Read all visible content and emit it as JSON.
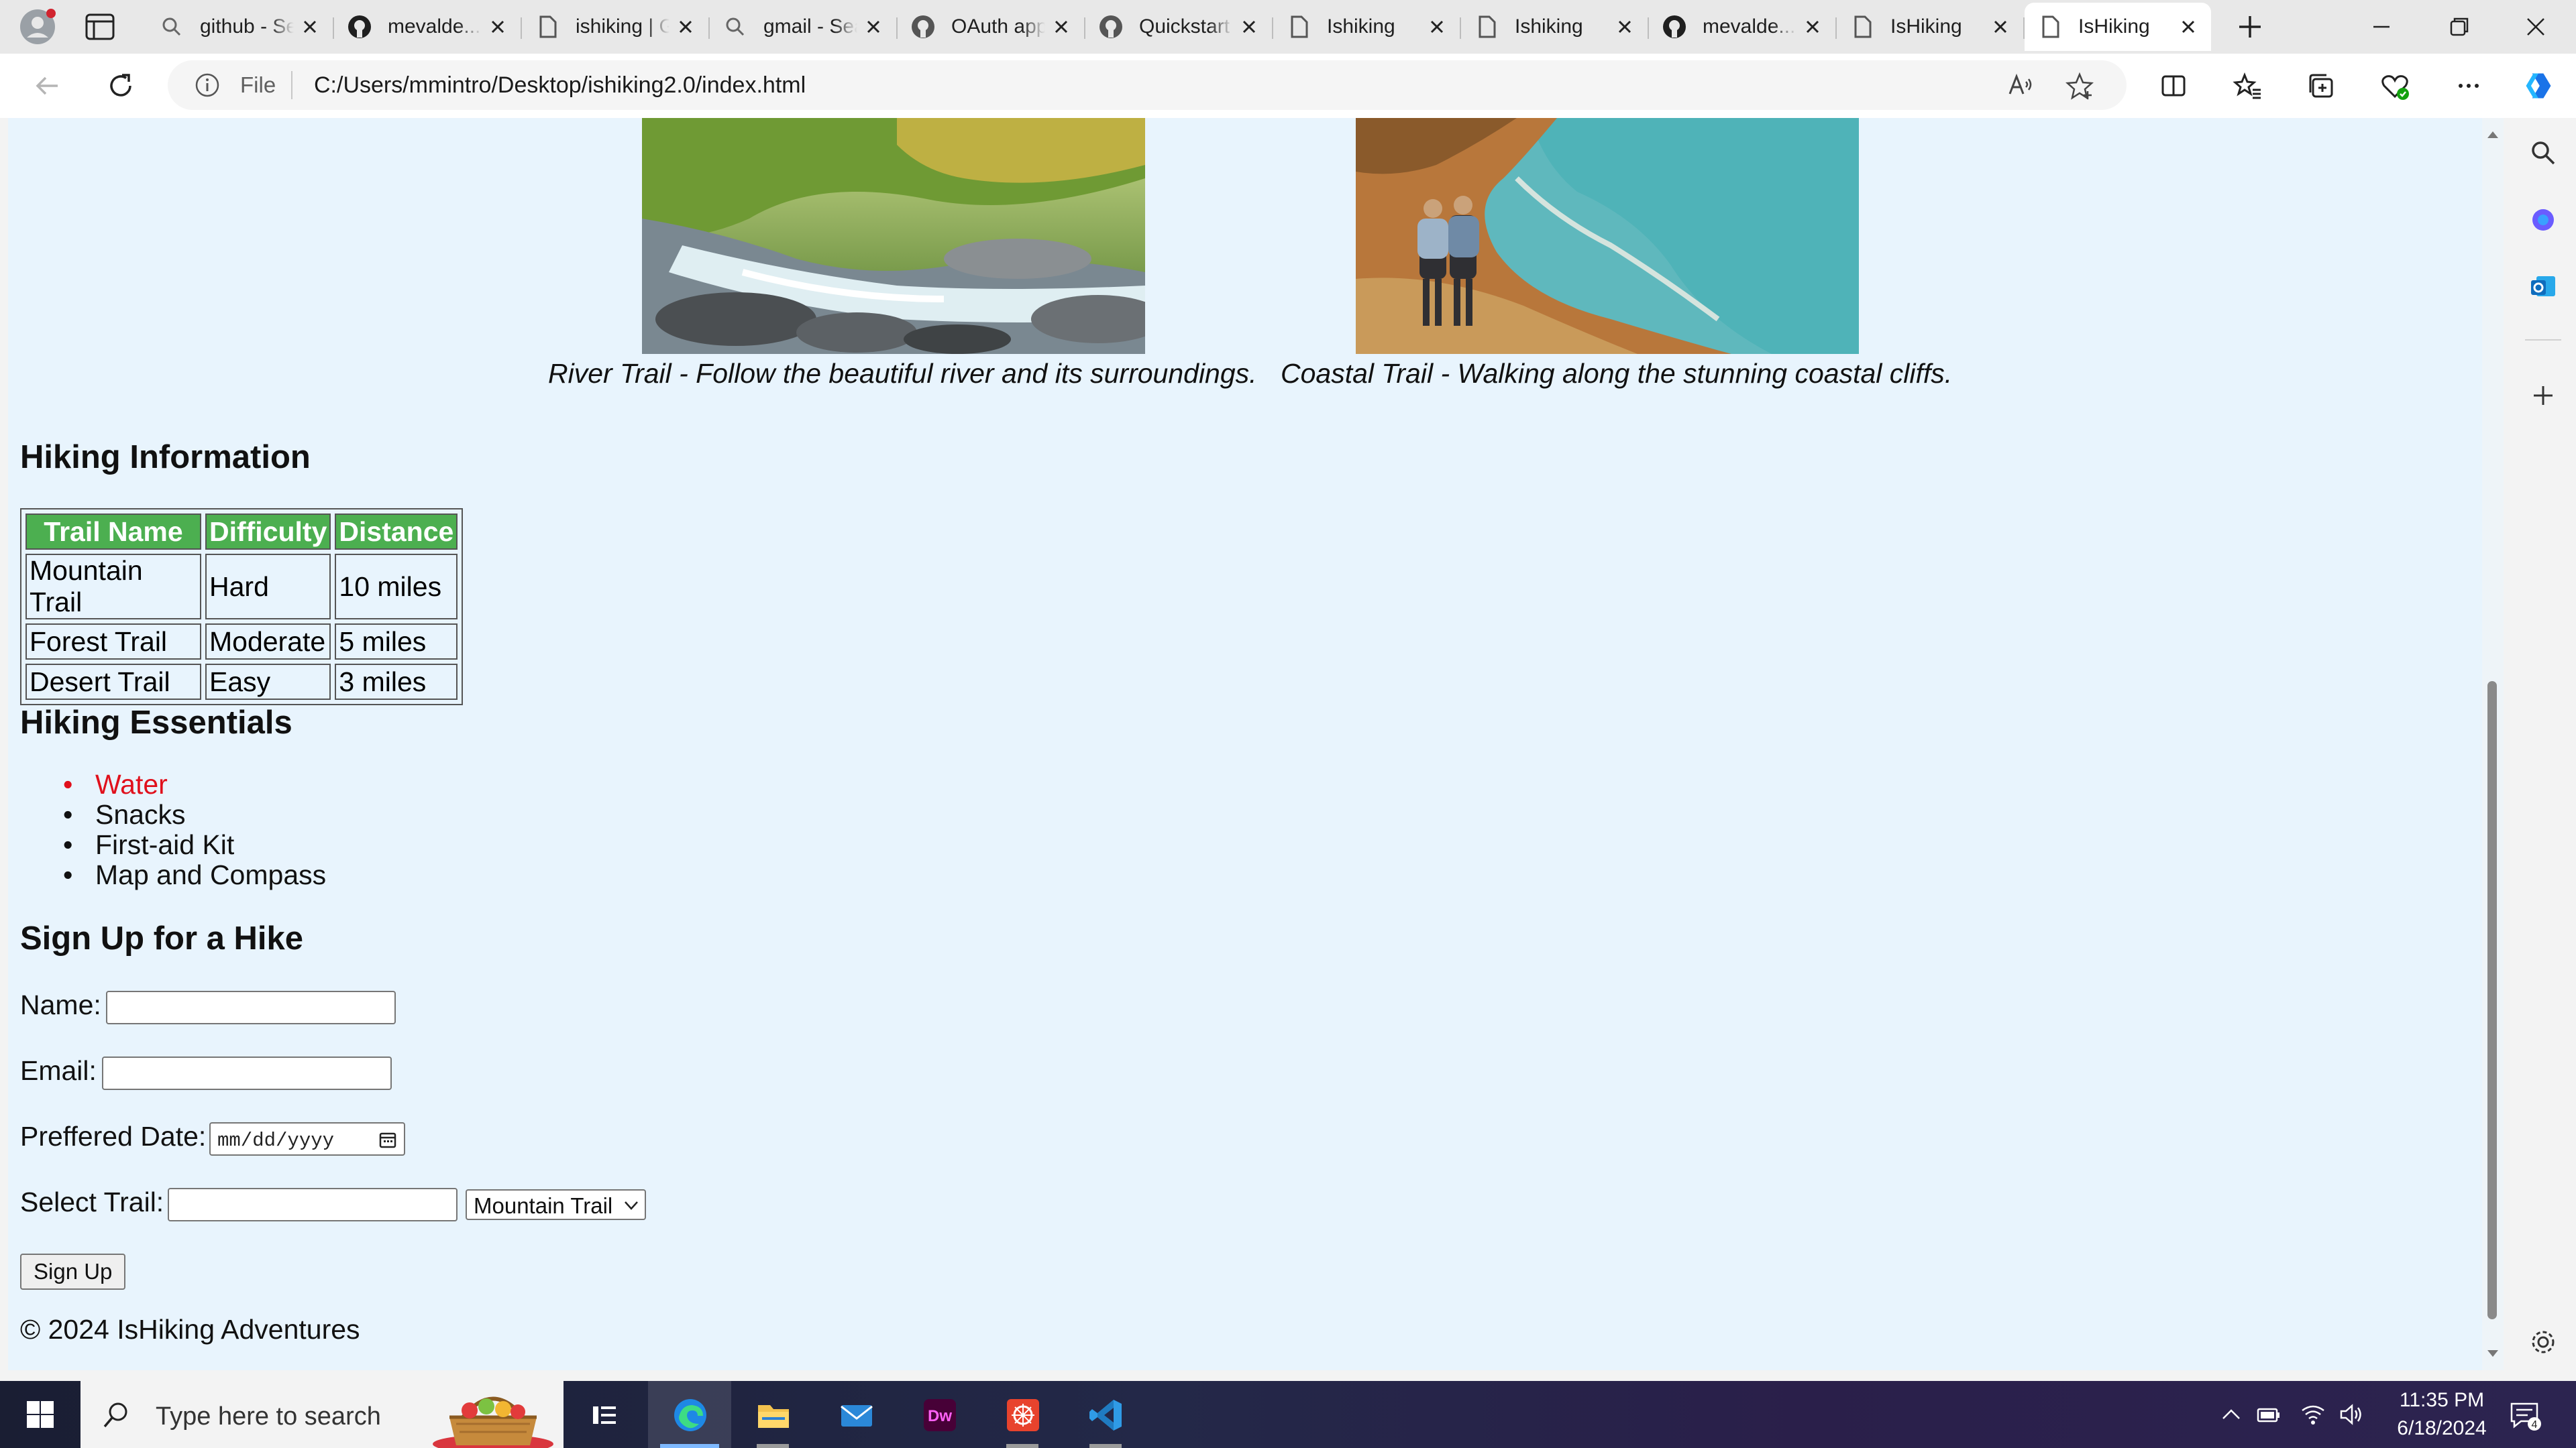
{
  "browser": {
    "tabs": [
      {
        "label": "github - Search",
        "icon": "search-icon"
      },
      {
        "label": "mevalde...",
        "icon": "github-icon"
      },
      {
        "label": "ishiking | GitHub",
        "icon": "page-icon"
      },
      {
        "label": "gmail - Search",
        "icon": "search-icon"
      },
      {
        "label": "OAuth apps",
        "icon": "github-icon"
      },
      {
        "label": "Quickstart",
        "icon": "github-icon"
      },
      {
        "label": "Ishiking",
        "icon": "page-icon"
      },
      {
        "label": "Ishiking",
        "icon": "page-icon"
      },
      {
        "label": "mevalde...",
        "icon": "github-icon"
      },
      {
        "label": "IsHiking",
        "icon": "page-icon"
      },
      {
        "label": "IsHiking",
        "icon": "page-icon",
        "active": true
      }
    ],
    "address": {
      "scheme": "File",
      "url": "C:/Users/mmintro/Desktop/ishiking2.0/index.html"
    }
  },
  "page": {
    "gallery": [
      {
        "caption": "River Trail - Follow the beautiful river and its surroundings."
      },
      {
        "caption": "Coastal Trail - Walking along the stunning coastal cliffs."
      }
    ],
    "info_heading": "Hiking Information",
    "table": {
      "headers": [
        "Trail Name",
        "Difficulty",
        "Distance"
      ],
      "rows": [
        [
          "Mountain Trail",
          "Hard",
          "10 miles"
        ],
        [
          "Forest Trail",
          "Moderate",
          "5 miles"
        ],
        [
          "Desert Trail",
          "Easy",
          "3 miles"
        ]
      ],
      "header_color": "#4caf50"
    },
    "essentials_heading": "Hiking Essentials",
    "essentials": [
      "Water",
      "Snacks",
      "First-aid Kit",
      "Map and Compass"
    ],
    "highlight_color": "#e0101c",
    "signup": {
      "heading": "Sign Up for a Hike",
      "name_label": "Name:",
      "email_label": "Email:",
      "date_label": "Preffered Date:",
      "date_placeholder": "mm/dd/yyyy",
      "trail_label": "Select Trail:",
      "trail_selected": "Mountain Trail",
      "button": "Sign Up"
    },
    "footer": "© 2024 IsHiking Adventures",
    "background": "#e8f4fd"
  },
  "taskbar": {
    "search_placeholder": "Type here to search",
    "apps": [
      "task-view",
      "edge",
      "file-explorer",
      "mail",
      "dreamweaver",
      "app-red",
      "vscode"
    ],
    "time": "11:35 PM",
    "date": "6/18/2024",
    "notification_count": "4"
  }
}
